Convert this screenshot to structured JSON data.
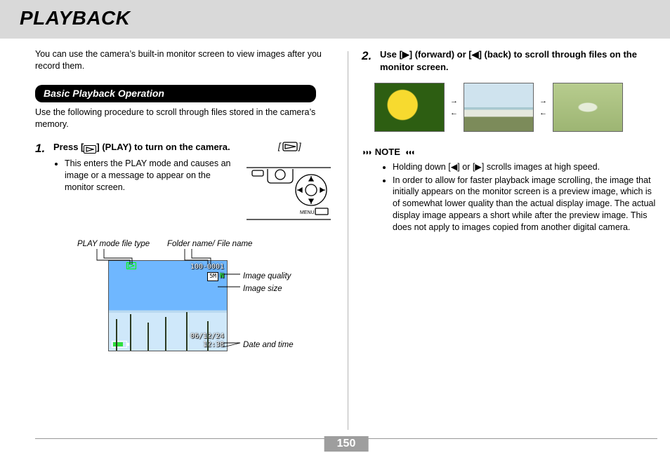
{
  "page": {
    "title": "PLAYBACK",
    "number": "150"
  },
  "left": {
    "intro": "You can use the camera’s built-in monitor screen to view images after you record them.",
    "section_title": "Basic Playback Operation",
    "section_desc": "Use the following procedure to scroll through files stored in the camera’s memory.",
    "step1": {
      "num": "1.",
      "text_a": "Press [",
      "text_b": "] (PLAY) to turn on the camera.",
      "bullet": "This enters the PLAY mode and causes an image or a message to appear on the monitor screen."
    },
    "annot": {
      "play_mode_file_type": "PLAY mode file type",
      "folder_file_name": "Folder name/ File name",
      "image_quality": "Image quality",
      "image_size": "Image size",
      "date_time": "Date and time",
      "osd": {
        "folder_file": "100-0001",
        "size": "5M",
        "quality": "N",
        "date": "06/12/24",
        "time": "12:38"
      }
    }
  },
  "right": {
    "step2": {
      "num": "2.",
      "text": "Use [▶] (forward) or [◀] (back) to scroll through files on the monitor screen."
    },
    "note_label": "NOTE",
    "note_items": [
      "Holding down [◀] or [▶] scrolls images at high speed.",
      "In order to allow for faster playback image scrolling, the image that initially appears on the monitor screen is a preview image, which is of somewhat lower quality than the actual display image. The actual display image appears a short while after the preview image. This does not apply to images copied from another digital camera."
    ]
  }
}
